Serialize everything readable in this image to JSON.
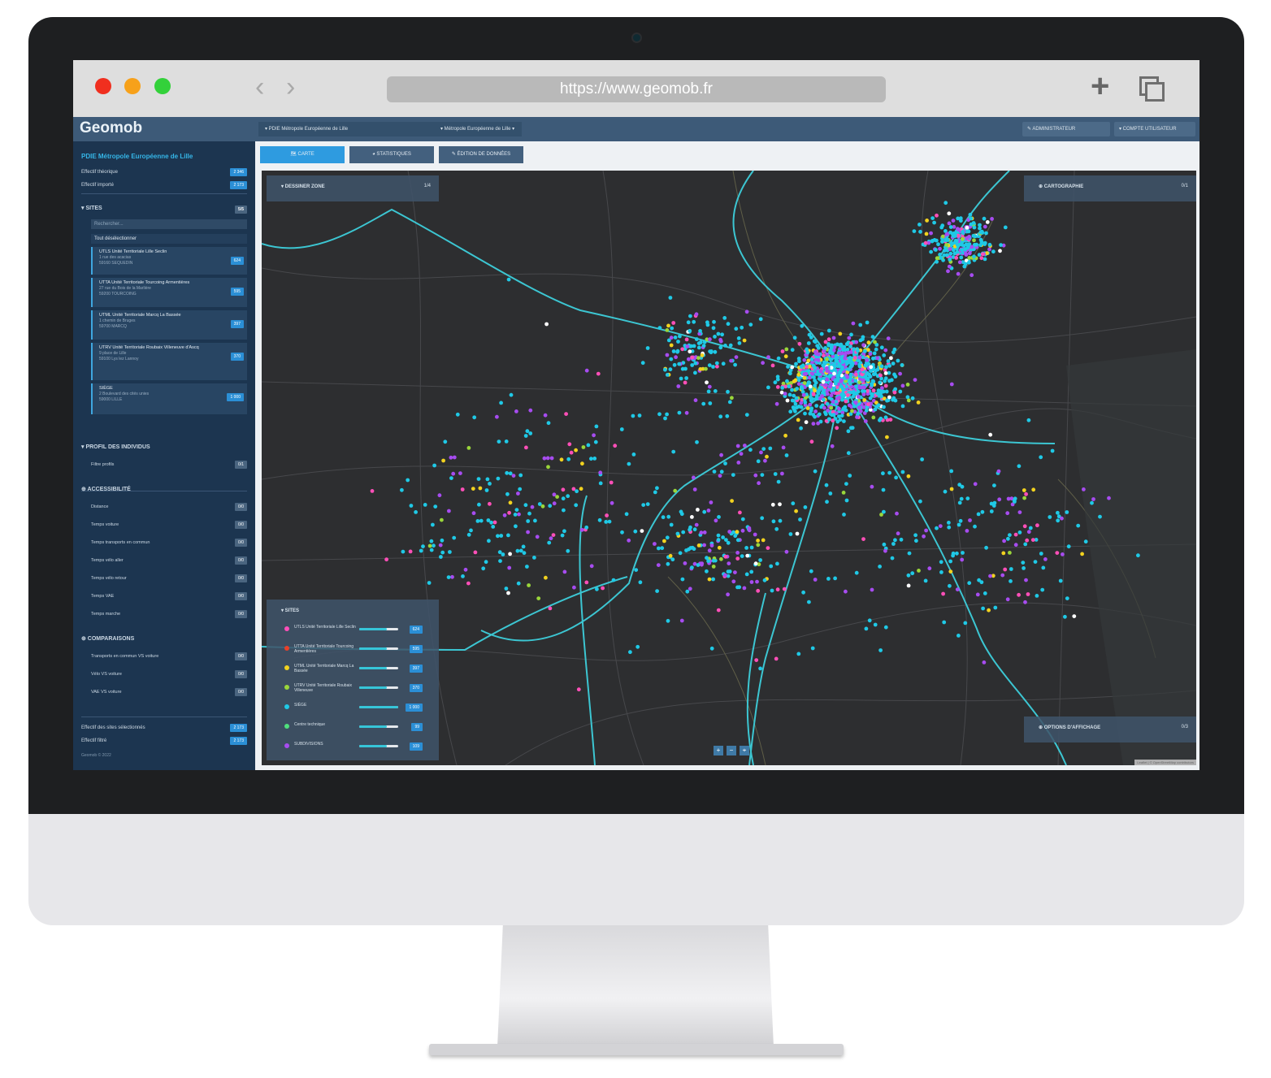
{
  "browser": {
    "url": "https://www.geomob.fr",
    "dot_colors": [
      "#f02f1f",
      "#f7a11a",
      "#33d13a"
    ],
    "back_icon": "chevron-left-icon",
    "forward_icon": "chevron-right-icon",
    "new_tab_icon": "plus-icon",
    "tabs_icon": "tabs-icon"
  },
  "app": {
    "logo": "Geomob",
    "org_select": "▾ PDIE Métropole Européenne de Lille",
    "territory_select": "▾ Métropole Européenne de Lille ▾",
    "admin_button": "✎ ADMINISTRATEUR",
    "account_button": "▾ COMPTE UTILISATEUR"
  },
  "sidebar": {
    "title": "PDIE Métropole Européenne de Lille",
    "effectif_theorique": {
      "label": "Effectif théorique",
      "value": "2 346"
    },
    "effectif_importe": {
      "label": "Effectif importé",
      "value": "2 173"
    },
    "sites_header": "▾ SITES",
    "sites_count": "5/5",
    "search_placeholder": "Rechercher...",
    "select_all": "Tout désélectionner",
    "sites": [
      {
        "title": "UTLS Unité Territoriale Lille Seclin",
        "sub1": "1 rue des acacias",
        "sub2": "59160 SEQUEDIN",
        "value": "624"
      },
      {
        "title": "UTTA Unité Territoriale Tourcoing Armentières",
        "sub1": "27 rue du Bois de la Marlière",
        "sub2": "59200 TOURCOING",
        "value": "595"
      },
      {
        "title": "UTML Unité Territoriale Marcq La Bassée",
        "sub1": "1 chemin de Bruges",
        "sub2": "59700 MARCQ",
        "value": "397"
      },
      {
        "title": "UTRV Unité Territoriale Roubaix Villeneuve d'Ascq",
        "sub1": "9 place de Lille",
        "sub2": "59100 Lys lez Lannoy",
        "value": "370"
      },
      {
        "title": "SIÈGE",
        "sub1": "2 Boulevard des cités unies",
        "sub2": "59000 LILLE",
        "value": "1 000"
      }
    ],
    "profile_header": "▾ PROFIL DES INDIVIDUS",
    "profile_item": {
      "label": "Filtre profils",
      "value": "0/1"
    },
    "access_header": "⊕ ACCESSIBILITÉ",
    "access_items": [
      "Distance",
      "Temps voiture",
      "Temps transports en commun",
      "Temps vélo aller",
      "Temps vélo retour",
      "Temps VAE",
      "Temps marche"
    ],
    "access_badge": "0/0",
    "compare_header": "⊕ COMPARAISONS",
    "compare_items": [
      "Transports en commun VS voiture",
      "Vélo VS voiture",
      "VAE VS voiture"
    ],
    "compare_badge": "0/0",
    "footer": {
      "selected": {
        "label": "Effectif des sites sélectionnés",
        "value": "2 173"
      },
      "filtered": {
        "label": "Effectif filtré",
        "value": "2 173"
      },
      "version": "Geomob © 2022"
    }
  },
  "tabs": {
    "map": "🗺 CARTE",
    "stats": "◕ STATISTIQUES",
    "edit": "✎ ÉDITION DE DONNÉES"
  },
  "map": {
    "filter_panel": {
      "title": "▾ DESSINER ZONE",
      "count": "1/4"
    },
    "carto_panel": {
      "title": "⊕ CARTOGRAPHIE",
      "count": "0/1"
    },
    "display_panel": {
      "title": "⊕ OPTIONS D'AFFICHAGE",
      "count": "0/3"
    },
    "legend": {
      "title": "▾ SITES",
      "rows": [
        {
          "name": "UTLS Unité Territoriale Lille Seclin",
          "color": "#ff4fb8",
          "value": "624",
          "fill": 0.7
        },
        {
          "name": "UTTA Unité Territoriale Tourcoing Armentières",
          "color": "#e8402a",
          "value": "595",
          "fill": 0.7
        },
        {
          "name": "UTML Unité Territoriale Marcq La Bassée",
          "color": "#f2d21f",
          "value": "397",
          "fill": 0.7
        },
        {
          "name": "UTRV Unité Territoriale Roubaix Villeneuve",
          "color": "#9ad63a",
          "value": "370",
          "fill": 0.7
        },
        {
          "name": "SIÈGE",
          "color": "#1fc9e6",
          "value": "1 000",
          "fill": 1.0
        },
        {
          "name": "Centre technique",
          "color": "#4fe07c",
          "value": "99",
          "fill": 0.7
        },
        {
          "name": "SUBDIVISIONS",
          "color": "#a74cf0",
          "value": "109",
          "fill": 0.7
        }
      ]
    },
    "zoom_in": "+",
    "zoom_out": "−",
    "locate": "⌖",
    "attribution": "Leaflet | © OpenStreetMap contributors"
  }
}
